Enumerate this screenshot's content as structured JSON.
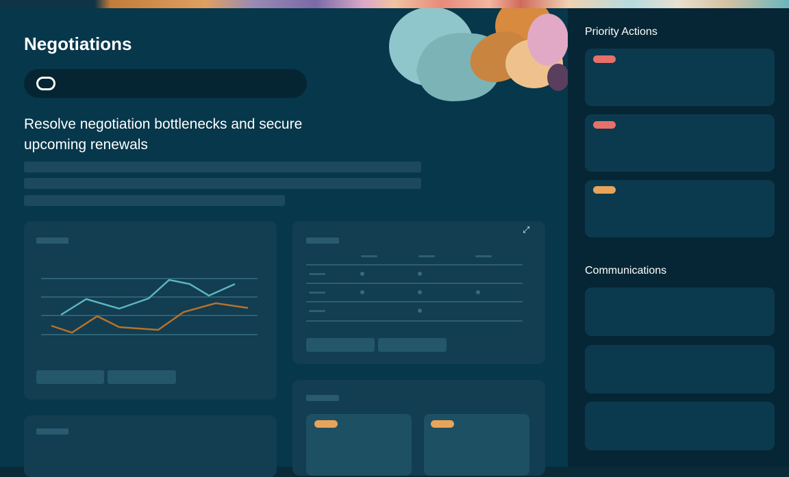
{
  "page": {
    "title": "Negotiations",
    "subtitle": "Resolve negotiation bottlenecks and secure upcoming renewals"
  },
  "sidebar": {
    "priority_heading": "Priority Actions",
    "communications_heading": "Communications"
  },
  "colors": {
    "background": "#07374b",
    "sidebar": "#062635",
    "card": "#133d50",
    "line_teal": "#5ab8c0",
    "line_orange": "#b8722c",
    "tag_red": "#e8706a",
    "tag_orange": "#e8a45a"
  },
  "icons": {
    "logo": "oracle-logo-icon",
    "expand": "expand-icon"
  }
}
